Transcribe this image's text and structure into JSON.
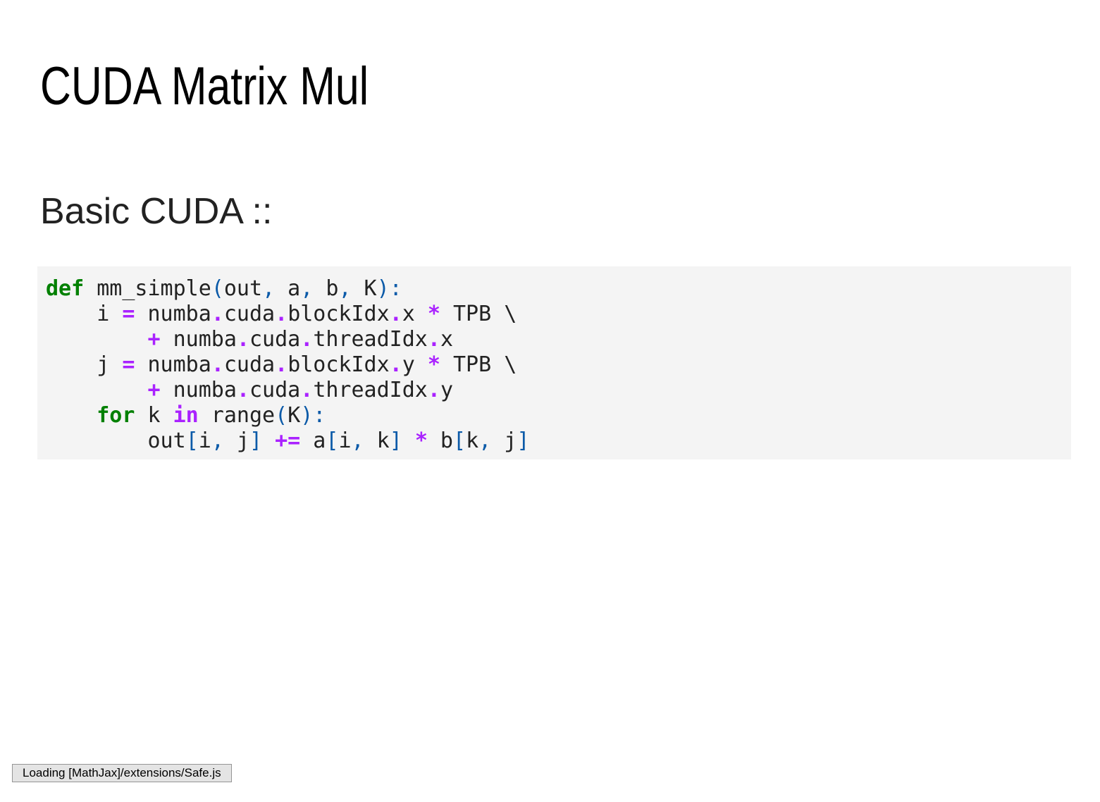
{
  "slide": {
    "title": "CUDA Matrix Mul",
    "subtitle": "Basic CUDA ::"
  },
  "code": {
    "language": "python",
    "lines": [
      [
        {
          "t": "kw",
          "v": "def"
        },
        {
          "t": "n",
          "v": " mm_simple"
        },
        {
          "t": "p",
          "v": "("
        },
        {
          "t": "n",
          "v": "out"
        },
        {
          "t": "p",
          "v": ","
        },
        {
          "t": "n",
          "v": " a"
        },
        {
          "t": "p",
          "v": ","
        },
        {
          "t": "n",
          "v": " b"
        },
        {
          "t": "p",
          "v": ","
        },
        {
          "t": "n",
          "v": " K"
        },
        {
          "t": "p",
          "v": "):"
        }
      ],
      [
        {
          "t": "n",
          "v": "    i "
        },
        {
          "t": "op",
          "v": "="
        },
        {
          "t": "n",
          "v": " numba"
        },
        {
          "t": "op",
          "v": "."
        },
        {
          "t": "n",
          "v": "cuda"
        },
        {
          "t": "op",
          "v": "."
        },
        {
          "t": "n",
          "v": "blockIdx"
        },
        {
          "t": "op",
          "v": "."
        },
        {
          "t": "n",
          "v": "x "
        },
        {
          "t": "op",
          "v": "*"
        },
        {
          "t": "n",
          "v": " TPB \\"
        }
      ],
      [
        {
          "t": "n",
          "v": "        "
        },
        {
          "t": "op",
          "v": "+"
        },
        {
          "t": "n",
          "v": " numba"
        },
        {
          "t": "op",
          "v": "."
        },
        {
          "t": "n",
          "v": "cuda"
        },
        {
          "t": "op",
          "v": "."
        },
        {
          "t": "n",
          "v": "threadIdx"
        },
        {
          "t": "op",
          "v": "."
        },
        {
          "t": "n",
          "v": "x"
        }
      ],
      [
        {
          "t": "n",
          "v": "    j "
        },
        {
          "t": "op",
          "v": "="
        },
        {
          "t": "n",
          "v": " numba"
        },
        {
          "t": "op",
          "v": "."
        },
        {
          "t": "n",
          "v": "cuda"
        },
        {
          "t": "op",
          "v": "."
        },
        {
          "t": "n",
          "v": "blockIdx"
        },
        {
          "t": "op",
          "v": "."
        },
        {
          "t": "n",
          "v": "y "
        },
        {
          "t": "op",
          "v": "*"
        },
        {
          "t": "n",
          "v": " TPB \\"
        }
      ],
      [
        {
          "t": "n",
          "v": "        "
        },
        {
          "t": "op",
          "v": "+"
        },
        {
          "t": "n",
          "v": " numba"
        },
        {
          "t": "op",
          "v": "."
        },
        {
          "t": "n",
          "v": "cuda"
        },
        {
          "t": "op",
          "v": "."
        },
        {
          "t": "n",
          "v": "threadIdx"
        },
        {
          "t": "op",
          "v": "."
        },
        {
          "t": "n",
          "v": "y"
        }
      ],
      [
        {
          "t": "n",
          "v": "    "
        },
        {
          "t": "kw",
          "v": "for"
        },
        {
          "t": "n",
          "v": " k "
        },
        {
          "t": "ow",
          "v": "in"
        },
        {
          "t": "n",
          "v": " range"
        },
        {
          "t": "p",
          "v": "("
        },
        {
          "t": "n",
          "v": "K"
        },
        {
          "t": "p",
          "v": "):"
        }
      ],
      [
        {
          "t": "n",
          "v": "        out"
        },
        {
          "t": "p",
          "v": "["
        },
        {
          "t": "n",
          "v": "i"
        },
        {
          "t": "p",
          "v": ","
        },
        {
          "t": "n",
          "v": " j"
        },
        {
          "t": "p",
          "v": "]"
        },
        {
          "t": "n",
          "v": " "
        },
        {
          "t": "op",
          "v": "+="
        },
        {
          "t": "n",
          "v": " a"
        },
        {
          "t": "p",
          "v": "["
        },
        {
          "t": "n",
          "v": "i"
        },
        {
          "t": "p",
          "v": ","
        },
        {
          "t": "n",
          "v": " k"
        },
        {
          "t": "p",
          "v": "]"
        },
        {
          "t": "n",
          "v": " "
        },
        {
          "t": "op",
          "v": "*"
        },
        {
          "t": "n",
          "v": " b"
        },
        {
          "t": "p",
          "v": "["
        },
        {
          "t": "n",
          "v": "k"
        },
        {
          "t": "p",
          "v": ","
        },
        {
          "t": "n",
          "v": " j"
        },
        {
          "t": "p",
          "v": "]"
        }
      ]
    ]
  },
  "status": {
    "message": "Loading [MathJax]/extensions/Safe.js"
  },
  "colors": {
    "keyword": "#008000",
    "operator": "#aa22ff",
    "punctuation": "#0b5aa8",
    "code_background": "#f4f4f4"
  }
}
